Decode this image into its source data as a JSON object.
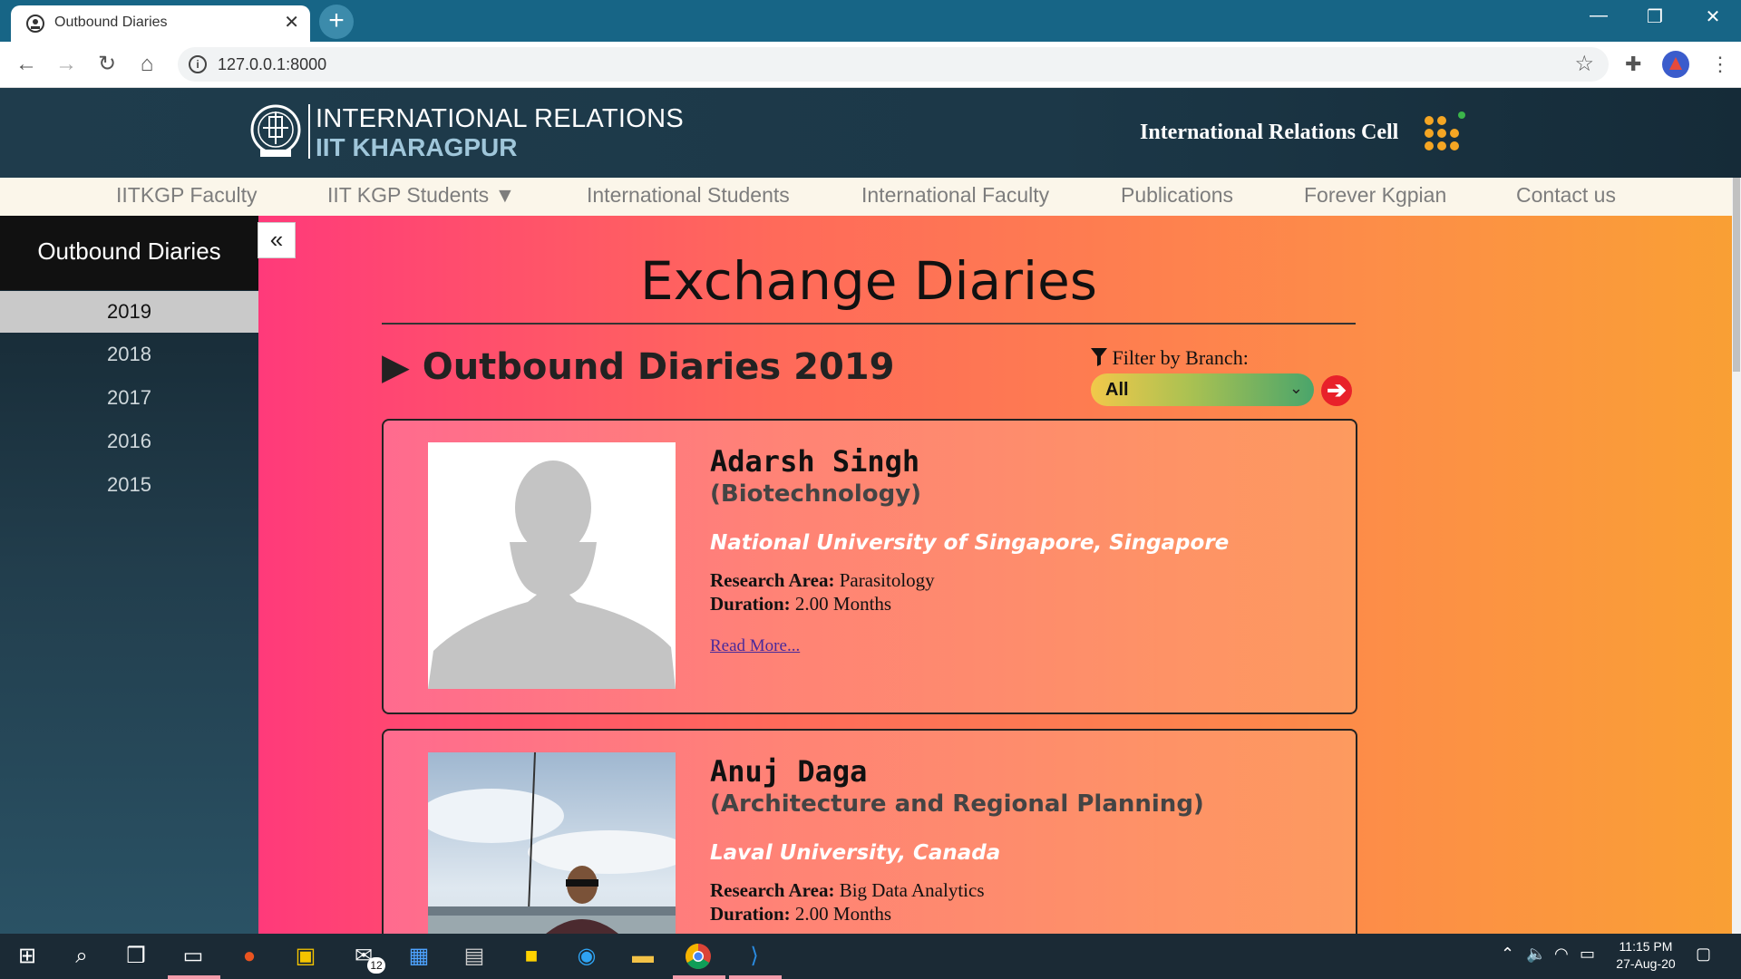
{
  "browser": {
    "tab_title": "Outbound Diaries",
    "url": "127.0.0.1:8000"
  },
  "header": {
    "logo_line1": "INTERNATIONAL RELATIONS",
    "logo_line2": "IIT KHARAGPUR",
    "cell_title": "International Relations Cell"
  },
  "nav": {
    "items": [
      "IITKGP Faculty",
      "IIT KGP Students ▼",
      "International Students",
      "International Faculty",
      "Publications",
      "Forever Kgpian",
      "Contact us"
    ]
  },
  "sidebar": {
    "title": "Outbound Diaries",
    "years": [
      "2019",
      "2018",
      "2017",
      "2016",
      "2015"
    ],
    "active_year": "2019",
    "collapse_glyph": "«"
  },
  "main": {
    "title": "Exchange Diaries",
    "section_title": "▶ Outbound Diaries 2019",
    "filter": {
      "label": "Filter by Branch:",
      "value": "All"
    }
  },
  "cards": [
    {
      "name": "Adarsh Singh",
      "branch": "(Biotechnology)",
      "university": "National University of Singapore, Singapore",
      "research_label": "Research Area:",
      "research": "Parasitology",
      "duration_label": "Duration:",
      "duration": "2.00 Months",
      "read_more": "Read More..."
    },
    {
      "name": "Anuj Daga",
      "branch": "(Architecture and Regional Planning)",
      "university": "Laval University, Canada",
      "research_label": "Research Area:",
      "research": "Big Data Analytics",
      "duration_label": "Duration:",
      "duration": "2.00 Months"
    }
  ],
  "taskbar": {
    "time": "11:15 PM",
    "date": "27-Aug-20",
    "mail_badge": "12"
  },
  "colors": {
    "tabbar": "#176586",
    "header": "#1f3c4c",
    "navbar": "#fbf6ea",
    "gradient_start": "#ff3a7a",
    "gradient_end": "#f9a034"
  }
}
